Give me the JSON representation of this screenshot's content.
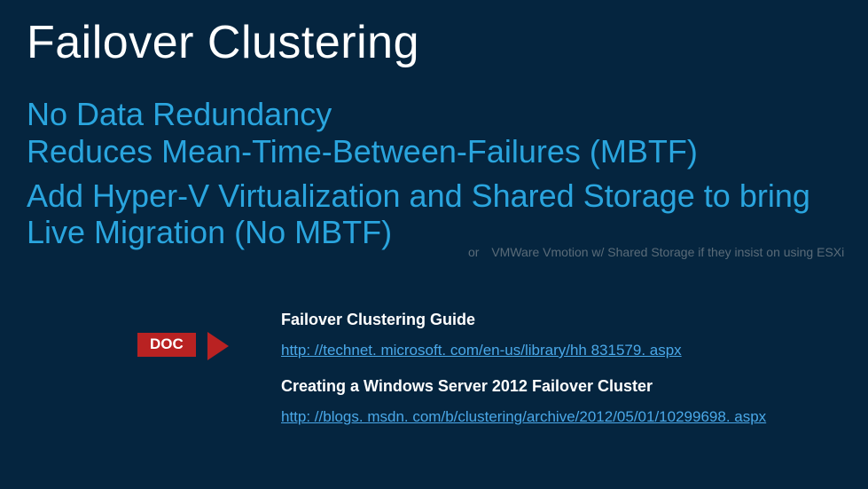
{
  "title": "Failover Clustering",
  "bullets": {
    "line1": "No Data Redundancy",
    "line2": "Reduces Mean-Time-Between-Failures (MBTF)",
    "line3": "Add Hyper-V Virtualization and Shared Storage to bring Live Migration (No MBTF)"
  },
  "aside": {
    "or": "or",
    "text": "VMWare Vmotion w/ Shared Storage if they insist on using ESXi"
  },
  "doc_badge": "DOC",
  "resources": [
    {
      "title": "Failover Clustering Guide",
      "link": "http: //technet. microsoft. com/en-us/library/hh 831579. aspx"
    },
    {
      "title": "Creating a Windows Server 2012 Failover Cluster",
      "link": "http: //blogs. msdn. com/b/clustering/archive/2012/05/01/10299698. aspx"
    }
  ]
}
